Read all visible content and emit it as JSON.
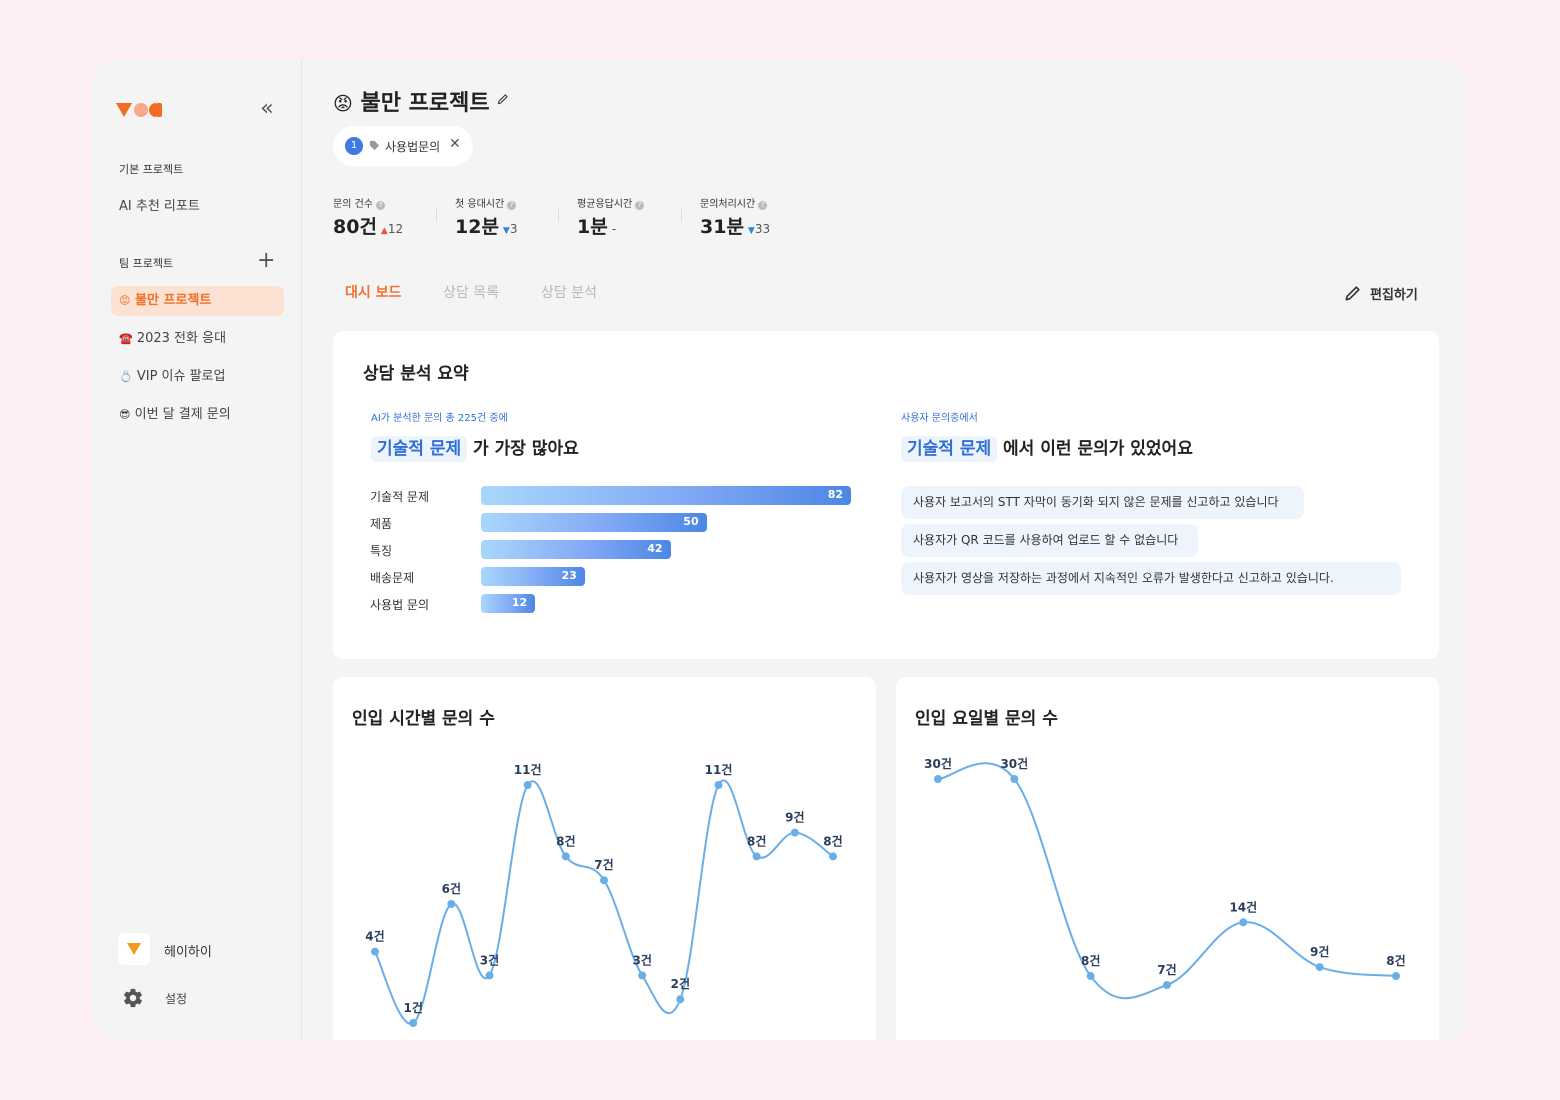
{
  "sidebar": {
    "basic_section": "기본 프로젝트",
    "ai_report": "AI 추천 리포트",
    "team_section": "팀 프로젝트",
    "items": [
      {
        "emoji": "😡",
        "label": "불만 프로젝트",
        "active": true
      },
      {
        "emoji": "☎️",
        "label": "2023 전화 응대",
        "active": false
      },
      {
        "emoji": "💍",
        "label": "VIP 이슈 팔로업",
        "active": false
      },
      {
        "emoji": "😎",
        "label": "이번 달 결제 문의",
        "active": false
      }
    ],
    "user_name": "헤이하이",
    "settings": "설정"
  },
  "header": {
    "emoji": "😡",
    "title": "불만 프로젝트",
    "filter_count": "1",
    "filter_label": "사용법문의",
    "filter_close": "✕"
  },
  "stats": [
    {
      "label": "문의 건수",
      "value": "80건",
      "delta": "12",
      "direction": "up"
    },
    {
      "label": "첫 응대시간",
      "value": "12분",
      "delta": "3",
      "direction": "down"
    },
    {
      "label": "평균응답시간",
      "value": "1분",
      "delta": "-",
      "direction": "none"
    },
    {
      "label": "문의처리시간",
      "value": "31분",
      "delta": "33",
      "direction": "down"
    }
  ],
  "tabs": [
    {
      "label": "대시 보드",
      "active": true
    },
    {
      "label": "상담 목록",
      "active": false
    },
    {
      "label": "상담 분석",
      "active": false
    }
  ],
  "edit_label": "편집하기",
  "summary": {
    "title": "상담 분석 요약",
    "left_caption": "AI가 분석한 문의 총 225건 중에",
    "left_highlight": "기술적 문제",
    "left_rest": "가 가장 많아요",
    "right_caption": "사용자 문의중에서",
    "right_highlight": "기술적 문제",
    "right_rest": "에서 이런 문의가 있었어요",
    "categories": [
      {
        "label": "기술적 문제",
        "value": 82
      },
      {
        "label": "제품",
        "value": 50
      },
      {
        "label": "특징",
        "value": 42
      },
      {
        "label": "배송문제",
        "value": 23
      },
      {
        "label": "사용법 문의",
        "value": 12
      }
    ],
    "inquiries": [
      "사용자 보고서의 STT 자막이 동기화 되지 않은 문제를 신고하고 있습니다",
      "사용자가 QR 코드를 사용하여 업로드 할 수 없습니다",
      "사용자가 영상을 저장하는 과정에서 지속적인 오류가 발생한다고 신고하고 있습니다."
    ]
  },
  "chart_data": [
    {
      "type": "line",
      "title": "인입 시간별 문의 수",
      "values": [
        4,
        1,
        6,
        3,
        11,
        8,
        7,
        3,
        2,
        11,
        8,
        9,
        8
      ],
      "labels": [
        "4건",
        "1건",
        "6건",
        "3건",
        "11건",
        "8건",
        "7건",
        "3건",
        "2건",
        "11건",
        "8건",
        "9건",
        "8건"
      ],
      "color": "#6aaee8"
    },
    {
      "type": "line",
      "title": "인입 요일별 문의 수",
      "values": [
        30,
        30,
        8,
        7,
        14,
        9,
        8
      ],
      "labels": [
        "30건",
        "30건",
        "8건",
        "7건",
        "14건",
        "9건",
        "8건"
      ],
      "color": "#6aaee8"
    }
  ],
  "colors": {
    "accent": "#f0702e",
    "blue": "#2f6fd6",
    "line": "#6aaee8"
  }
}
